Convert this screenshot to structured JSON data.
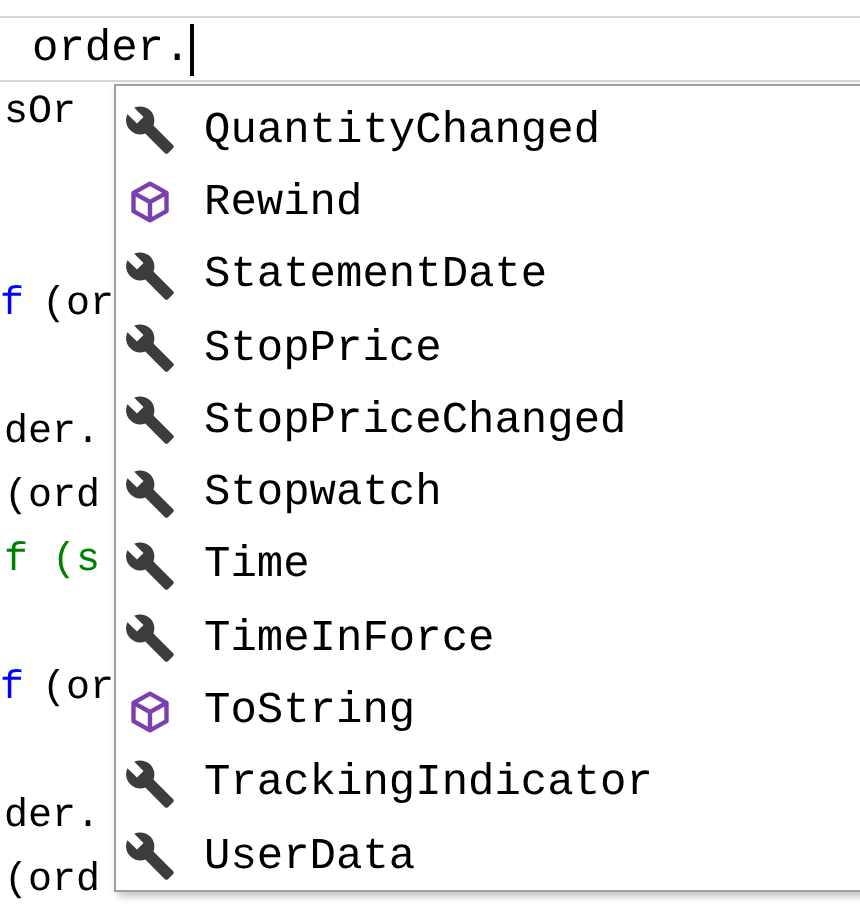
{
  "editor": {
    "current_line": {
      "text": "order."
    },
    "lines": [
      {
        "kind": "code",
        "segments": [
          {
            "text": "sOr",
            "kind": "plain"
          }
        ]
      },
      {
        "kind": "blank"
      },
      {
        "kind": "blank"
      },
      {
        "kind": "code",
        "segments": [
          {
            "text": "f",
            "kind": "keyword"
          },
          {
            "text": " (or",
            "kind": "plain"
          }
        ]
      },
      {
        "kind": "blank"
      },
      {
        "kind": "code",
        "segments": [
          {
            "text": "der.",
            "kind": "plain"
          }
        ]
      },
      {
        "kind": "code",
        "segments": [
          {
            "text": "(ord",
            "kind": "plain"
          }
        ]
      },
      {
        "kind": "code",
        "segments": [
          {
            "text": "f (s",
            "kind": "comment"
          }
        ]
      },
      {
        "kind": "blank"
      },
      {
        "kind": "code",
        "segments": [
          {
            "text": "f",
            "kind": "keyword"
          },
          {
            "text": " (or",
            "kind": "plain"
          }
        ]
      },
      {
        "kind": "blank"
      },
      {
        "kind": "code",
        "segments": [
          {
            "text": "der.",
            "kind": "plain"
          }
        ]
      },
      {
        "kind": "code",
        "segments": [
          {
            "text": "(ord",
            "kind": "plain"
          }
        ]
      }
    ]
  },
  "completion_list": {
    "items": [
      {
        "label": "QuantityChanged",
        "kind": "property"
      },
      {
        "label": "Rewind",
        "kind": "method"
      },
      {
        "label": "StatementDate",
        "kind": "property"
      },
      {
        "label": "StopPrice",
        "kind": "property"
      },
      {
        "label": "StopPriceChanged",
        "kind": "property"
      },
      {
        "label": "Stopwatch",
        "kind": "property"
      },
      {
        "label": "Time",
        "kind": "property"
      },
      {
        "label": "TimeInForce",
        "kind": "property"
      },
      {
        "label": "ToString",
        "kind": "method"
      },
      {
        "label": "TrackingIndicator",
        "kind": "property"
      },
      {
        "label": "UserData",
        "kind": "property"
      }
    ]
  }
}
